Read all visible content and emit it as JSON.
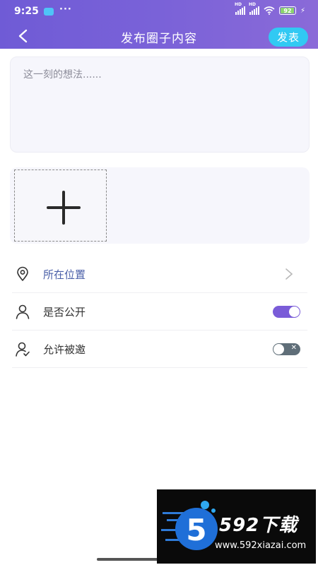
{
  "status_bar": {
    "time": "9:25",
    "dots": "···",
    "signal_1_tag": "HD",
    "signal_2_tag": "HD",
    "battery": "92"
  },
  "header": {
    "title": "发布圈子内容",
    "publish_label": "发表"
  },
  "composer": {
    "placeholder": "这一刻的想法......"
  },
  "options": [
    {
      "label": "所在位置",
      "icon": "location-pin-icon",
      "control": "chevron"
    },
    {
      "label": "是否公开",
      "icon": "person-icon",
      "control": "toggle",
      "enabled": true
    },
    {
      "label": "允许被邀",
      "icon": "person-check-icon",
      "control": "toggle",
      "enabled": false
    }
  ],
  "watermark": {
    "brand": "592下载",
    "url": "www.592xiazai.com",
    "logo_digit": "5"
  },
  "colors": {
    "header_start": "#6f5bd6",
    "header_end": "#8a6ad8",
    "publish_button": "#31c9f3",
    "toggle_on": "#7a5cd8",
    "toggle_off": "#5f6e78"
  }
}
